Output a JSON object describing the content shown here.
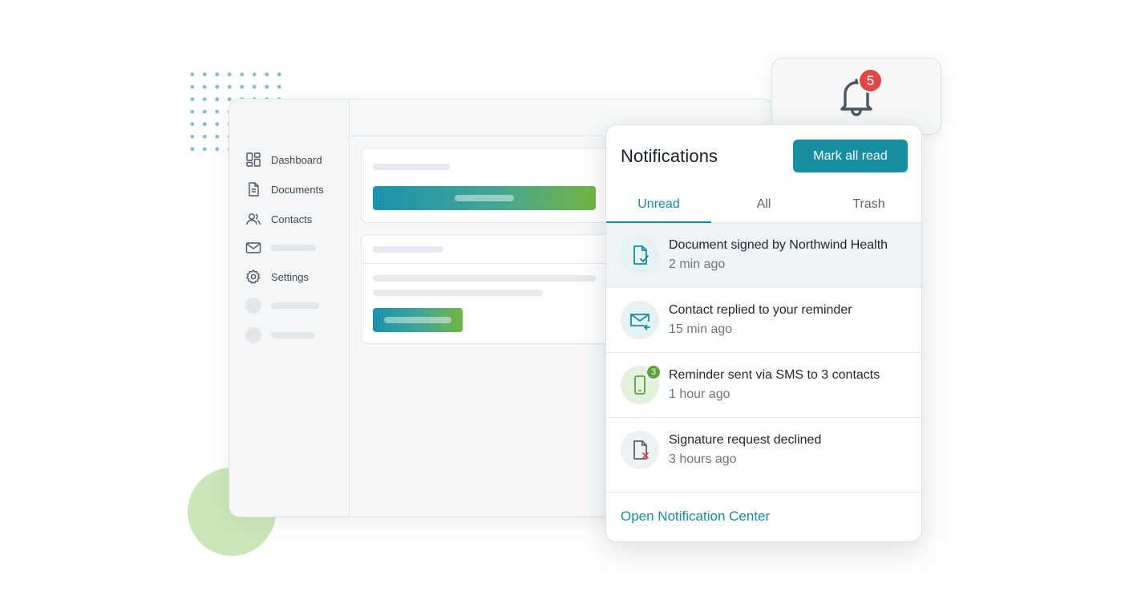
{
  "sidebar": {
    "items": [
      {
        "label": "Dashboard",
        "icon": "dashboard-icon"
      },
      {
        "label": "Documents",
        "icon": "document-icon"
      },
      {
        "label": "Contacts",
        "icon": "contacts-icon"
      },
      {
        "label": "",
        "icon": "mail-icon"
      },
      {
        "label": "Settings",
        "icon": "gear-icon"
      }
    ]
  },
  "bell": {
    "badge_count": "5"
  },
  "notifications": {
    "title": "Notifications",
    "mark_all_read": "Mark all read",
    "tabs": [
      {
        "label": "Unread",
        "active": true
      },
      {
        "label": "All",
        "active": false
      },
      {
        "label": "Trash",
        "active": false
      }
    ],
    "items": [
      {
        "title": "Document signed by Northwind Health",
        "time": "2 min ago",
        "icon": "document-signed-icon"
      },
      {
        "title": "Contact replied to your reminder",
        "time": "15 min ago",
        "icon": "mail-reply-icon"
      },
      {
        "title": "Reminder sent via SMS to 3 contacts",
        "time": "1 hour ago",
        "icon": "smartphone-icon",
        "badge": "3"
      },
      {
        "title": "Signature request declined",
        "time": "3 hours ago",
        "icon": "document-declined-icon"
      }
    ],
    "footer_link": "Open Notification Center"
  },
  "colors": {
    "accent": "#188ea1",
    "badge_red": "#e04848",
    "badge_green": "#5ba33a",
    "decline_red": "#d9434b"
  }
}
